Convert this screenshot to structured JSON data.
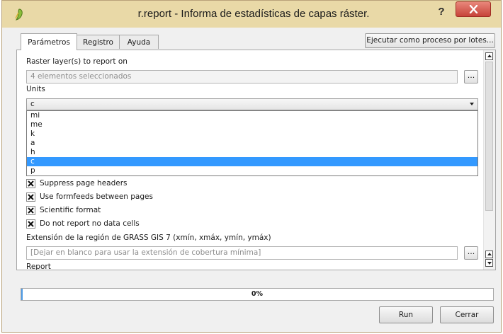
{
  "window": {
    "title": "r.report - Informa de estadísticas de capas ráster.",
    "help_label": "?",
    "close_icon": "close-x-icon",
    "app_icon": "qgis-icon"
  },
  "tabs": [
    {
      "label": "Parámetros",
      "active": true
    },
    {
      "label": "Registro",
      "active": false
    },
    {
      "label": "Ayuda",
      "active": false
    }
  ],
  "batch_button": "Ejecutar como proceso por lotes...",
  "raster_layers": {
    "label": "Raster layer(s) to report on",
    "value": "4 elementos seleccionados",
    "button_label": "..."
  },
  "units": {
    "label": "Units",
    "selected": "c",
    "options": [
      "mi",
      "me",
      "k",
      "a",
      "h",
      "c",
      "p"
    ],
    "highlighted_index": 5
  },
  "checkboxes": [
    {
      "label": "Suppress page headers",
      "checked": true
    },
    {
      "label": "Use formfeeds between pages",
      "checked": true
    },
    {
      "label": "Scientific format",
      "checked": true
    },
    {
      "label": "Do not report no data cells",
      "checked": true
    }
  ],
  "region": {
    "label": "Extensión de la región de GRASS GIS 7 (xmín, xmáx, ymín, ymáx)",
    "placeholder": "[Dejar en blanco para usar la extensión de cobertura mínima]",
    "button_label": "..."
  },
  "report_label": "Report",
  "progress": {
    "value": 0,
    "text": "0%"
  },
  "buttons": {
    "run": "Run",
    "close": "Cerrar"
  },
  "colors": {
    "titlebar": "#e9d9a7",
    "close_button": "#c7433a",
    "selection": "#3399ff",
    "progress_fill": "#4d9be6"
  }
}
